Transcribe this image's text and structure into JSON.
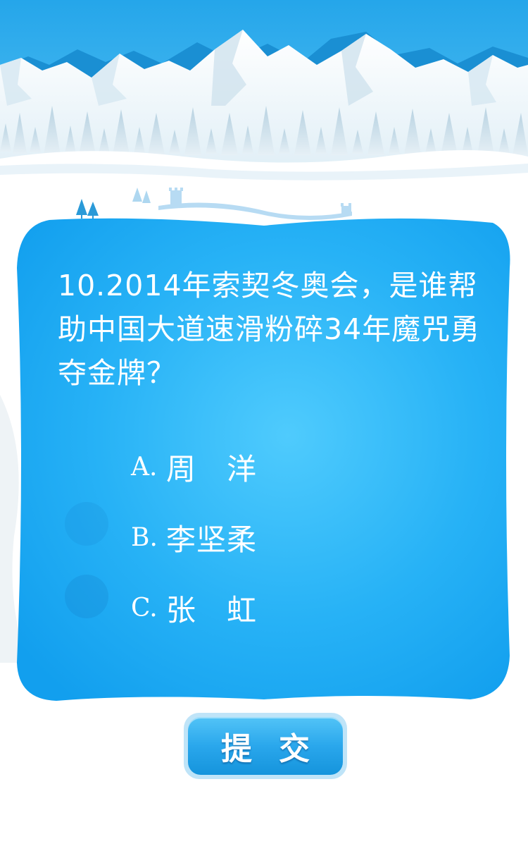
{
  "colors": {
    "sky": "#27a9ea",
    "card": "#1eaaf5",
    "card_light": "#45c5fb",
    "text": "#ffffff",
    "button": "#2aa7ec"
  },
  "quiz": {
    "question": "10.2014年索契冬奥会，是谁帮助中国大道速滑粉碎34年魔咒勇夺金牌？",
    "options": [
      {
        "letter": "A.",
        "text": "周　洋"
      },
      {
        "letter": "B.",
        "text": "李坚柔"
      },
      {
        "letter": "C.",
        "text": "张　虹"
      }
    ],
    "submit_label": "提交"
  },
  "icons": [
    "mountain-scenery",
    "pine-tree-icon",
    "great-wall-icon",
    "answer-marker-icon"
  ]
}
